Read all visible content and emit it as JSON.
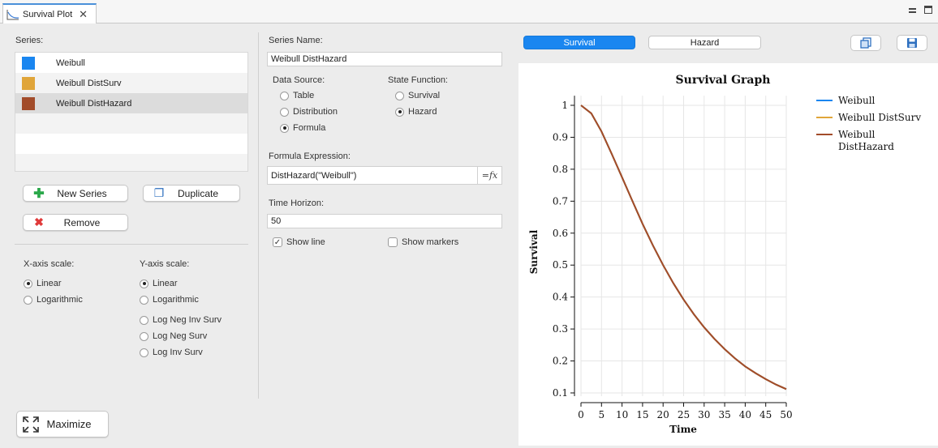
{
  "tab": {
    "title": "Survival Plot"
  },
  "series_panel": {
    "label": "Series:",
    "items": [
      {
        "name": "Weibull",
        "color": "#1a86f0"
      },
      {
        "name": "Weibull DistSurv",
        "color": "#e0a53a"
      },
      {
        "name": "Weibull DistHazard",
        "color": "#a24c2a",
        "selected": true
      }
    ],
    "buttons": {
      "new_series": "New Series",
      "duplicate": "Duplicate",
      "remove": "Remove"
    }
  },
  "axis_scale": {
    "x_label": "X-axis scale:",
    "x_options": [
      "Linear",
      "Logarithmic"
    ],
    "x_selected": "Linear",
    "y_label": "Y-axis scale:",
    "y_options": [
      "Linear",
      "Logarithmic",
      "Log Neg Inv Surv",
      "Log Neg Surv",
      "Log Inv Surv"
    ],
    "y_selected": "Linear"
  },
  "maximize_label": "Maximize",
  "settings": {
    "series_name_label": "Series Name:",
    "series_name_value": "Weibull DistHazard",
    "data_source_label": "Data Source:",
    "data_source_options": [
      "Table",
      "Distribution",
      "Formula"
    ],
    "data_source_selected": "Formula",
    "state_function_label": "State Function:",
    "state_function_options": [
      "Survival",
      "Hazard"
    ],
    "state_function_selected": "Hazard",
    "formula_label": "Formula Expression:",
    "formula_value": "DistHazard(\"Weibull\")",
    "formula_button": "=fx",
    "time_horizon_label": "Time Horizon:",
    "time_horizon_value": "50",
    "show_line_label": "Show line",
    "show_line_checked": true,
    "show_markers_label": "Show markers",
    "show_markers_checked": false
  },
  "view_toggle": {
    "survival": "Survival",
    "hazard": "Hazard",
    "active": "Survival"
  },
  "accent_color": "#1a86f0",
  "chart_data": {
    "type": "line",
    "title": "Survival Graph",
    "xlabel": "Time",
    "ylabel": "Survival",
    "xlim": [
      0,
      50
    ],
    "ylim": [
      0.1,
      1
    ],
    "x_ticks": [
      0,
      5,
      10,
      15,
      20,
      25,
      30,
      35,
      40,
      45,
      50
    ],
    "y_ticks": [
      0.1,
      0.2,
      0.3,
      0.4,
      0.5,
      0.6,
      0.7,
      0.8,
      0.9,
      1
    ],
    "grid": true,
    "legend_position": "top-right",
    "legend": [
      "Weibull",
      "Weibull DistSurv",
      "Weibull DistHazard"
    ],
    "series": [
      {
        "name": "Weibull",
        "color": "#1a86f0",
        "x": [
          0,
          2.5,
          5,
          7.5,
          10,
          12.5,
          15,
          17.5,
          20,
          22.5,
          25,
          27.5,
          30,
          32.5,
          35,
          37.5,
          40,
          42.5,
          45,
          47.5,
          50
        ],
        "values": [
          1.0,
          0.975,
          0.918,
          0.848,
          0.775,
          0.701,
          0.629,
          0.562,
          0.5,
          0.443,
          0.392,
          0.346,
          0.305,
          0.269,
          0.237,
          0.208,
          0.183,
          0.162,
          0.143,
          0.126,
          0.112
        ]
      },
      {
        "name": "Weibull DistSurv",
        "color": "#e0a53a",
        "x": [
          0,
          2.5,
          5,
          7.5,
          10,
          12.5,
          15,
          17.5,
          20,
          22.5,
          25,
          27.5,
          30,
          32.5,
          35,
          37.5,
          40,
          42.5,
          45,
          47.5,
          50
        ],
        "values": [
          1.0,
          0.975,
          0.918,
          0.848,
          0.775,
          0.701,
          0.629,
          0.562,
          0.5,
          0.443,
          0.392,
          0.346,
          0.305,
          0.269,
          0.237,
          0.208,
          0.183,
          0.162,
          0.143,
          0.126,
          0.112
        ]
      },
      {
        "name": "Weibull DistHazard",
        "color": "#a24c2a",
        "x": [
          0,
          2.5,
          5,
          7.5,
          10,
          12.5,
          15,
          17.5,
          20,
          22.5,
          25,
          27.5,
          30,
          32.5,
          35,
          37.5,
          40,
          42.5,
          45,
          47.5,
          50
        ],
        "values": [
          1.0,
          0.975,
          0.918,
          0.848,
          0.775,
          0.701,
          0.629,
          0.562,
          0.5,
          0.443,
          0.392,
          0.346,
          0.305,
          0.269,
          0.237,
          0.208,
          0.183,
          0.162,
          0.143,
          0.126,
          0.112
        ]
      }
    ]
  }
}
